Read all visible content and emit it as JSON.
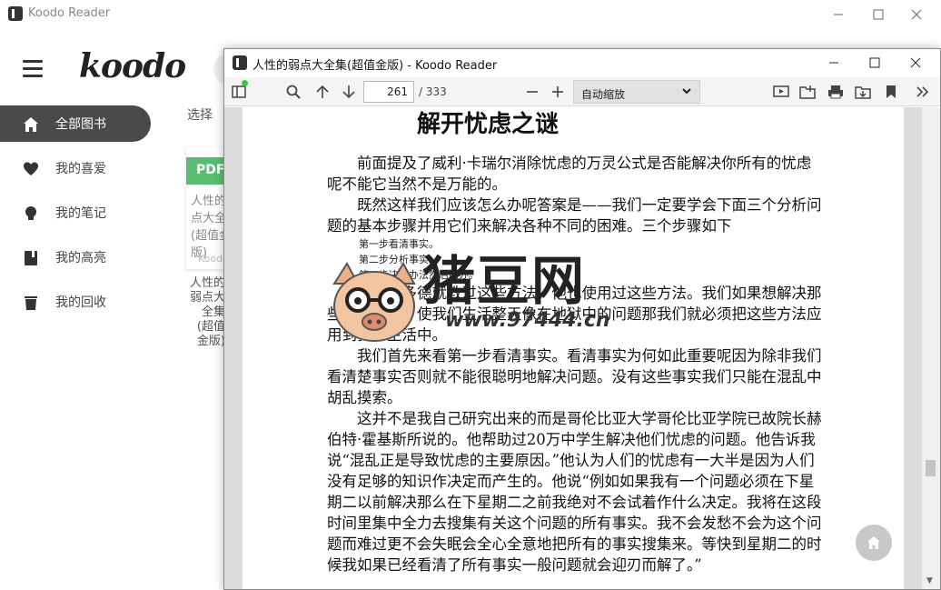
{
  "main_window": {
    "title": "Koodo Reader",
    "logo": "koodo",
    "select_label": "选择",
    "sidebar": {
      "items": [
        {
          "label": "全部图书",
          "icon": "home-icon",
          "active": true
        },
        {
          "label": "我的喜爱",
          "icon": "heart-icon",
          "active": false
        },
        {
          "label": "我的笔记",
          "icon": "bulb-icon",
          "active": false
        },
        {
          "label": "我的高亮",
          "icon": "highlight-book-icon",
          "active": false
        },
        {
          "label": "我的回收",
          "icon": "trash-icon",
          "active": false
        }
      ]
    },
    "book_card": {
      "badge": "PDF",
      "badge_color": "#5bbd72",
      "cover_title": "人性的弱点大全集(超值金版)",
      "cover_author": "Koodo",
      "caption": "人性的弱点大全集(超值金版)"
    }
  },
  "reader_window": {
    "title": "人性的弱点大全集(超值金版) - Koodo Reader",
    "toolbar": {
      "current_page": "261",
      "total_pages": "/ 333",
      "zoom_label": "自动缩放"
    },
    "page": {
      "chapter_title": "解开忧虑之谜",
      "paragraphs": [
        "前面提及了威利·卡瑞尔消除忧虑的万灵公式是否能解决你所有的忧虑呢不能它当然不是万能的。",
        "既然这样我们应该怎么办呢答案是——我们一定要学会下面三个分析问题的基本步骤并用它们来解决各种不同的困难。三个步骤如下"
      ],
      "steps": [
        "第一步看清事实。",
        "第二步分析事实。",
        "第二步决定办法然后照办。"
      ],
      "paragraphs_after": [
        "亚里士多德就教过这些方法，他也使用过这些方法。我们如果想解决那些压迫我们、使我们生活整天像在地狱中的问题那我们就必须把这些方法应用到实际生活中。",
        "我们首先来看第一步看清事实。看清事实为何如此重要呢因为除非我们看清楚事实否则就不能很聪明地解决问题。没有这些事实我们只能在混乱中胡乱摸索。",
        "这并不是我自己研究出来的而是哥伦比亚大学哥伦比亚学院已故院长赫伯特·霍基斯所说的。他帮助过20万中学生解决他们忧虑的问题。他告诉我说“混乱正是导致忧虑的主要原因。”他认为人们的忧虑有一大半是因为人们没有足够的知识作决定而产生的。他说“例如如果我有一个问题必须在下星期二以前解决那么在下星期二之前我绝对不会试着作什么决定。我将在这段时间里集中全力去搜集有关这个问题的所有事实。我不会发愁不会为这个问题而难过更不会失眠会全心全意地把所有的事实搜集来。等快到星期二的时候我如果已经看清了所有事实一般问题就会迎刃而解了。”"
      ]
    }
  },
  "watermark": {
    "logo_text": "猪豆网",
    "url": "www.97444.cn"
  }
}
